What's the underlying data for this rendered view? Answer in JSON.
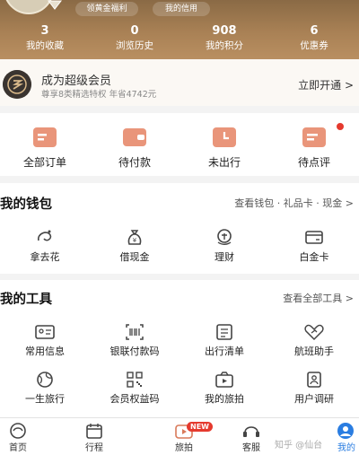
{
  "header": {
    "pill_left": "领黄金福利",
    "pill_right": "我的信用",
    "stats": [
      {
        "num": "3",
        "label": "我的收藏"
      },
      {
        "num": "0",
        "label": "浏览历史"
      },
      {
        "num": "908",
        "label": "我的积分"
      },
      {
        "num": "6",
        "label": "优惠券"
      }
    ]
  },
  "member": {
    "title": "成为超级会员",
    "subtitle": "尊享8类精选特权 年省4742元",
    "cta": "立即开通 >"
  },
  "orders": [
    {
      "label": "全部订单",
      "icon": "all-orders-icon"
    },
    {
      "label": "待付款",
      "icon": "wallet-icon"
    },
    {
      "label": "未出行",
      "icon": "clock-icon"
    },
    {
      "label": "待点评",
      "icon": "review-icon"
    }
  ],
  "wallet": {
    "title": "我的钱包",
    "link": "查看钱包 · 礼品卡 · 现金 >",
    "items": [
      {
        "label": "拿去花",
        "icon": "swirl-icon"
      },
      {
        "label": "借现金",
        "icon": "money-bag-icon"
      },
      {
        "label": "理财",
        "icon": "finance-icon"
      },
      {
        "label": "白金卡",
        "icon": "card-icon"
      }
    ]
  },
  "tools": {
    "title": "我的工具",
    "link": "查看全部工具 >",
    "items": [
      {
        "label": "常用信息",
        "icon": "id-card-icon"
      },
      {
        "label": "银联付款码",
        "icon": "barcode-icon"
      },
      {
        "label": "出行清单",
        "icon": "checklist-icon"
      },
      {
        "label": "航班助手",
        "icon": "heart-plane-icon"
      },
      {
        "label": "一生旅行",
        "icon": "globe-icon"
      },
      {
        "label": "会员权益码",
        "icon": "qr-code-icon"
      },
      {
        "label": "我的旅拍",
        "icon": "camera-icon"
      },
      {
        "label": "用户调研",
        "icon": "survey-icon"
      }
    ]
  },
  "tabbar": {
    "items": [
      {
        "label": "首页",
        "icon": "home-icon"
      },
      {
        "label": "行程",
        "icon": "calendar-icon"
      },
      {
        "label": "旅拍",
        "icon": "video-icon"
      },
      {
        "label": "客服",
        "icon": "headset-icon"
      },
      {
        "label": "我的",
        "icon": "profile-icon"
      }
    ],
    "new_badge": "NEW"
  },
  "watermark": "知乎 @仙台",
  "colors": {
    "header_brown": "#a98155",
    "icon_accent": "#d97a5a",
    "badge_red": "#e53a2e",
    "active_tab": "#2a7de1"
  }
}
